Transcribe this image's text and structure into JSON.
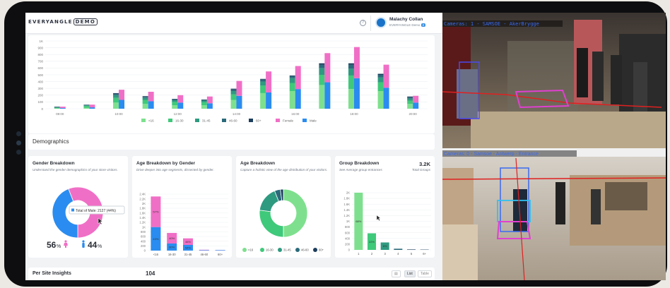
{
  "app": {
    "logo_text": "EVERYANGLE",
    "logo_badge": "DEMO"
  },
  "user": {
    "name": "Malachy Collan",
    "org": "EVERYANGLE Demo",
    "badge": "2"
  },
  "header": {
    "help_icon": "help-circle-icon"
  },
  "hourly_chart": {
    "y_ticks": [
      "0",
      "100",
      "200",
      "300",
      "400",
      "500",
      "600",
      "700",
      "800",
      "900",
      "1K"
    ],
    "legend": [
      "<16",
      "16-30",
      "31-45",
      "46-60",
      "60+",
      "Female",
      "Male"
    ]
  },
  "demographics": {
    "title": "Demographics"
  },
  "gender": {
    "title": "Gender Breakdown",
    "subtitle": "Understand the gender demographics of your store visitors.",
    "tooltip": "Total of Male: 2127 (44%)",
    "female_pct": "56",
    "male_pct": "44",
    "pct_sign": "%"
  },
  "age_gender": {
    "title": "Age Breakdown by Gender",
    "subtitle": "Drive deeper into age segments, dissected by gender.",
    "y_ticks": [
      "0",
      "200",
      "400",
      "600",
      "800",
      "1K",
      "1.2K",
      "1.4K",
      "1.6K",
      "1.8K",
      "2K",
      "2.2K",
      "2.4K"
    ]
  },
  "age": {
    "title": "Age Breakdown",
    "subtitle": "Capture a holistic view of the age distribution of your visitors.",
    "legend": [
      "<16",
      "16-30",
      "31-45",
      "46-60",
      "60+"
    ]
  },
  "group": {
    "title": "Group Breakdown",
    "subtitle": "See Average group entrances",
    "total": "3.2K",
    "total_label": "Total Groups",
    "y_ticks": [
      "0",
      "200",
      "400",
      "600",
      "800",
      "1K",
      "1.2K",
      "1.4K",
      "1.6K",
      "1.8K",
      "2K"
    ]
  },
  "per_site": {
    "label": "Per Site Insights",
    "count": "104",
    "toggle_list": "List",
    "toggle_table": "Table"
  },
  "cameras": [
    {
      "label": "Cameras: 1 - SAMSOE - AkerBrygge"
    },
    {
      "label": "Cameras: 0 - Samsoe - Antwerp - Entrance"
    }
  ],
  "colors": {
    "u16": "#7ee08e",
    "a16_30": "#3fc97a",
    "a31_45": "#2e9a80",
    "a46_60": "#2a6a7a",
    "a60p": "#1c3d5c",
    "female": "#f06fc6",
    "male": "#2a8cf0"
  },
  "chart_data": [
    {
      "type": "bar",
      "title": "",
      "categories": [
        "08:00",
        "09:00",
        "10:00",
        "11:00",
        "12:00",
        "13:00",
        "14:00",
        "15:00",
        "16:00",
        "17:00",
        "18:00",
        "19:00",
        "20:00"
      ],
      "x_tick_labels": [
        "08:00",
        "",
        "10:00",
        "",
        "12:00",
        "",
        "14:00",
        "",
        "16:00",
        "",
        "18:00",
        "",
        "20:00"
      ],
      "stacked_groups": [
        "age",
        "gender"
      ],
      "series": [
        {
          "name": "<16",
          "stack": "age",
          "values": [
            5,
            15,
            90,
            70,
            50,
            50,
            130,
            230,
            260,
            350,
            290,
            260,
            70
          ]
        },
        {
          "name": "16-30",
          "stack": "age",
          "values": [
            10,
            25,
            70,
            60,
            50,
            45,
            80,
            110,
            120,
            150,
            200,
            130,
            50
          ]
        },
        {
          "name": "31-45",
          "stack": "age",
          "values": [
            5,
            10,
            40,
            30,
            25,
            25,
            50,
            60,
            70,
            100,
            100,
            70,
            30
          ]
        },
        {
          "name": "46-60",
          "stack": "age",
          "values": [
            5,
            5,
            20,
            15,
            15,
            10,
            25,
            30,
            30,
            50,
            60,
            40,
            20
          ]
        },
        {
          "name": "60+",
          "stack": "age",
          "values": [
            5,
            5,
            10,
            10,
            5,
            5,
            10,
            10,
            10,
            20,
            20,
            15,
            10
          ]
        },
        {
          "name": "Female",
          "stack": "gender",
          "values": [
            20,
            40,
            150,
            140,
            110,
            100,
            220,
            310,
            340,
            430,
            460,
            340,
            100
          ]
        },
        {
          "name": "Male",
          "stack": "gender",
          "values": [
            10,
            20,
            130,
            110,
            90,
            80,
            190,
            240,
            290,
            390,
            450,
            310,
            90
          ]
        }
      ],
      "ylim": [
        0,
        1000
      ]
    },
    {
      "type": "pie",
      "title": "Gender Breakdown",
      "labels": [
        "Female",
        "Male"
      ],
      "values": [
        56,
        44
      ]
    },
    {
      "type": "bar",
      "title": "Age Breakdown by Gender",
      "categories": [
        "<16",
        "16-30",
        "31-45",
        "46-60",
        "60+"
      ],
      "series": [
        {
          "name": "Male",
          "values": [
            1000,
            300,
            240,
            20,
            20
          ]
        },
        {
          "name": "Female",
          "values": [
            1300,
            450,
            280,
            15,
            5
          ]
        }
      ],
      "data_labels": [
        "57%",
        "43%",
        "40%",
        "60%",
        "46%",
        "54%"
      ],
      "ylim": [
        0,
        2400
      ]
    },
    {
      "type": "pie",
      "title": "Age Breakdown",
      "labels": [
        "<16",
        "16-30",
        "31-45",
        "46-60",
        "60+"
      ],
      "values": [
        50,
        27,
        17,
        4,
        2
      ]
    },
    {
      "type": "bar",
      "title": "Group Breakdown",
      "categories": [
        "1",
        "2",
        "3",
        "4",
        "5",
        "6+"
      ],
      "values": [
        2000,
        580,
        260,
        40,
        15,
        10
      ],
      "data_labels": [
        "68%",
        "22%",
        "8%"
      ],
      "ylim": [
        0,
        2000
      ]
    }
  ]
}
